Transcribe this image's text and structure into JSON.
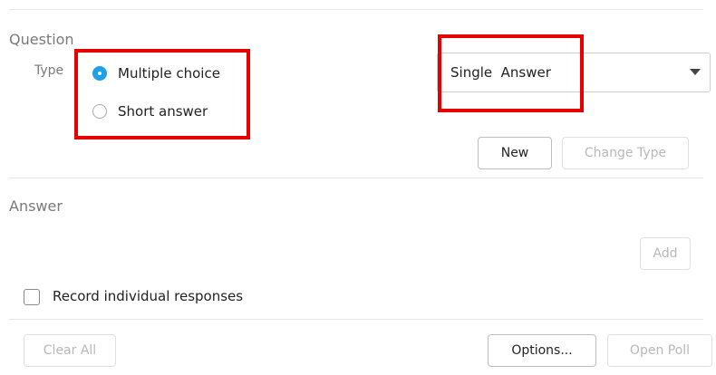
{
  "question": {
    "section_label": "Question",
    "type_label": "Type",
    "options": [
      {
        "label": "Multiple choice",
        "checked": true
      },
      {
        "label": "Short answer",
        "checked": false
      }
    ],
    "answer_mode": {
      "selected": "Single  Answer"
    },
    "new_button": "New",
    "change_type_button": "Change Type"
  },
  "answer": {
    "section_label": "Answer",
    "add_button": "Add",
    "record_responses_label": "Record individual responses",
    "record_responses_checked": false
  },
  "footer": {
    "clear_all_button": "Clear All",
    "options_button": "Options...",
    "open_poll_button": "Open Poll"
  },
  "highlight_color": "#e60000",
  "accent_color": "#1ea0e6"
}
